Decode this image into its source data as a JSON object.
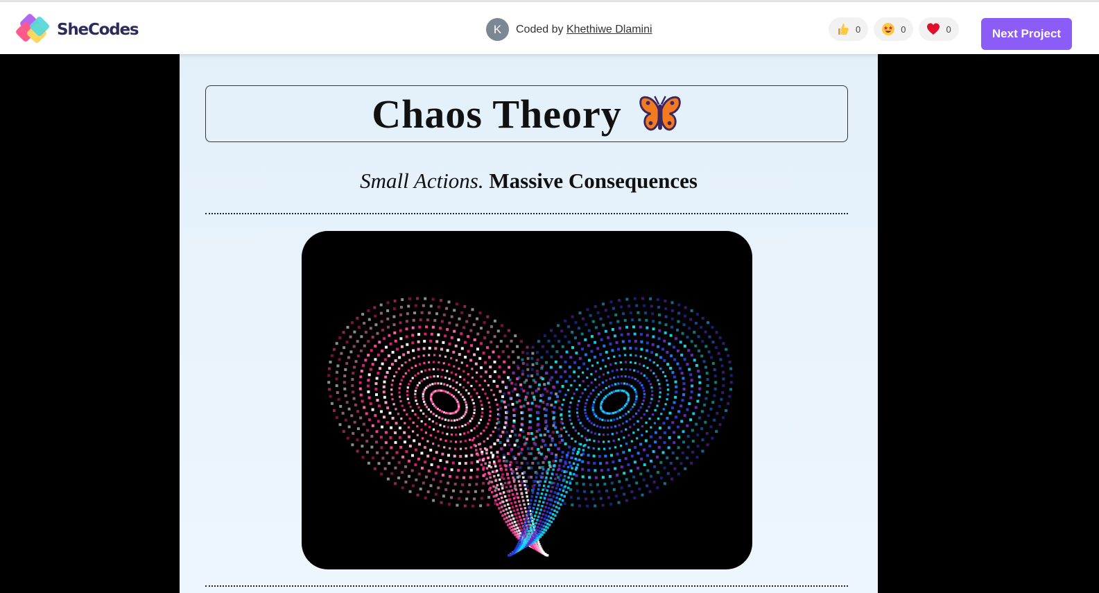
{
  "header": {
    "logo_text": "SheCodes",
    "avatar_initial": "K",
    "coded_by_label": "Coded by",
    "coder_name": "Khethiwe Dlamini",
    "reactions": [
      {
        "icon": "thumbs-up-icon",
        "count": "0"
      },
      {
        "icon": "star-struck-icon",
        "count": "0"
      },
      {
        "icon": "heart-icon",
        "count": "0"
      }
    ],
    "next_button": "Next Project",
    "accent_color": "#8b5cf6"
  },
  "main": {
    "title": "Chaos Theory",
    "title_icon": "butterfly-icon",
    "subtitle_italic": "Small Actions.",
    "subtitle_bold": "Massive Consequences",
    "image": {
      "icon": "lorenz-attractor-butterfly-image",
      "colors": {
        "left_wing": "#ff3f9a",
        "right_wing": "#19c8ff"
      }
    }
  }
}
